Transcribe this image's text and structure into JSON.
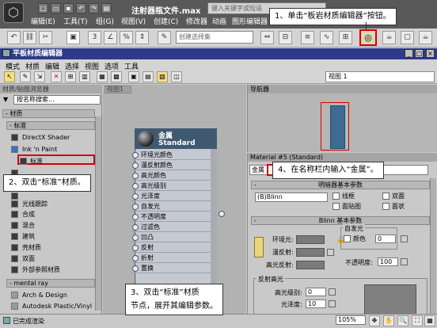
{
  "app": {
    "file_title": "注射器瓶文件.max",
    "search_placeholder": "键入关键字或短语",
    "menu": [
      "编辑(E)",
      "工具(T)",
      "组(G)",
      "视图(V)",
      "创建(C)",
      "修改器",
      "动画",
      "图形编辑器"
    ],
    "selection_set_placeholder": "创建选择集"
  },
  "editor": {
    "title": "平板材质编辑器",
    "menu": [
      "模式",
      "材质",
      "编辑",
      "选择",
      "视图",
      "选项",
      "工具"
    ],
    "view_select": "视图 1",
    "view_tab": "视图1",
    "zoom": "105%",
    "status": "已完成渲染"
  },
  "browser": {
    "header": "材质/贴图浏览器",
    "search_placeholder": "按名称搜索...",
    "group_materials": "- 材质",
    "group_standard": "- 标准",
    "standard_items": [
      "DirectX Shader",
      "Ink 'n Paint",
      "标准",
      "",
      "",
      "",
      "光线跟踪",
      "合成",
      "混合",
      "建筑",
      "壳材质",
      "双面",
      "外部参照材质"
    ],
    "group_mentalray": "- mental ray",
    "mentalray_items": [
      "Arch & Design",
      "Autodesk Plastic/Vinyl"
    ]
  },
  "node": {
    "name": "金属",
    "type": "Standard",
    "slots": [
      "环境光颜色",
      "漫反射颜色",
      "高光颜色",
      "高光级别",
      "光泽度",
      "自发光",
      "不透明度",
      "过滤色",
      "凹凸",
      "反射",
      "折射",
      "置换"
    ]
  },
  "navigator": {
    "header": "导航器"
  },
  "params": {
    "header": "Material #5 (Standard)",
    "name_value": "金属",
    "rollout_shader": "明暗器基本参数",
    "shader_type": "(B)Blinn",
    "opt_wire": "线框",
    "opt_twosided": "双面",
    "opt_facemap": "面贴图",
    "opt_faceted": "面状",
    "rollout_blinn": "Blinn 基本参数",
    "self_illum": "自发光",
    "color_label": "颜色",
    "self_illum_value": "0",
    "ambient": "环境光:",
    "diffuse": "漫反射:",
    "specular": "高光反射:",
    "opacity_label": "不透明度:",
    "opacity_value": "100",
    "spec_highlights": "反射高光",
    "spec_level": "高光级别:",
    "spec_level_value": "0",
    "glossiness": "光泽度:",
    "glossiness_value": "10"
  },
  "callouts": {
    "c1": "1、单击“板岩材质编辑器”按钮。",
    "c2": "2、双击“标准”材质。",
    "c3": "3、双击“标准”材质\n节点，展开其编辑参数。",
    "c4": "4、在名称栏内输入“金属”。"
  }
}
